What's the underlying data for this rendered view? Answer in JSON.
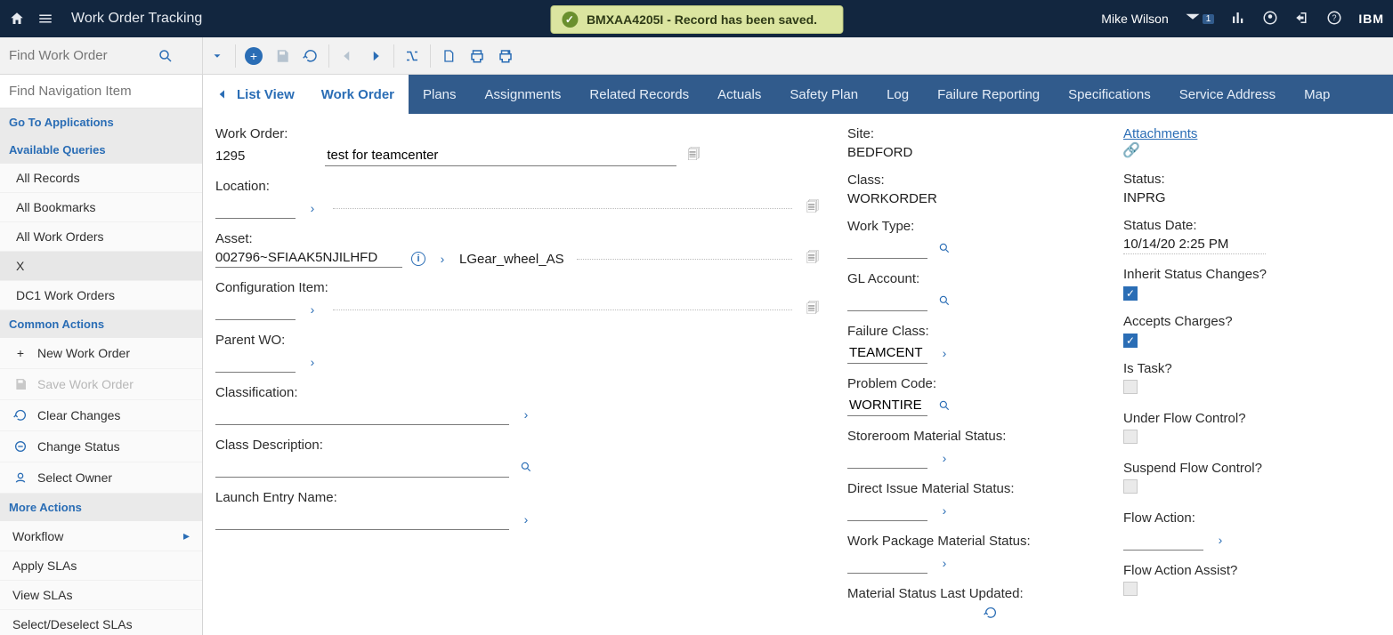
{
  "header": {
    "title": "Work Order Tracking",
    "user": "Mike Wilson",
    "badge_count": "1",
    "brand": "IBM"
  },
  "banner": {
    "text": "BMXAA4205I - Record has been saved."
  },
  "toolbar": {
    "find_placeholder": "Find Work Order"
  },
  "sidebar": {
    "nav_placeholder": "Find Navigation Item",
    "goto_head": "Go To Applications",
    "queries_head": "Available Queries",
    "queries": [
      {
        "label": "All Records"
      },
      {
        "label": "All Bookmarks"
      },
      {
        "label": "All Work Orders"
      },
      {
        "label": "X"
      },
      {
        "label": "DC1 Work Orders"
      }
    ],
    "common_head": "Common Actions",
    "common": [
      {
        "label": "New Work Order",
        "icon": "plus",
        "disabled": false
      },
      {
        "label": "Save Work Order",
        "icon": "save",
        "disabled": true
      },
      {
        "label": "Clear Changes",
        "icon": "undo",
        "disabled": false
      },
      {
        "label": "Change Status",
        "icon": "status",
        "disabled": false
      },
      {
        "label": "Select Owner",
        "icon": "owner",
        "disabled": false
      }
    ],
    "more_head": "More Actions",
    "more": [
      {
        "label": "Workflow",
        "arrow": true
      },
      {
        "label": "Apply SLAs"
      },
      {
        "label": "View SLAs"
      },
      {
        "label": "Select/Deselect SLAs"
      }
    ]
  },
  "tabs": {
    "back": "List View",
    "items": [
      "Work Order",
      "Plans",
      "Assignments",
      "Related Records",
      "Actuals",
      "Safety Plan",
      "Log",
      "Failure Reporting",
      "Specifications",
      "Service Address",
      "Map"
    ],
    "active": 0
  },
  "form": {
    "col1": {
      "work_order_label": "Work Order:",
      "work_order_num": "1295",
      "work_order_desc": "test for teamcenter",
      "location_label": "Location:",
      "location_val": "",
      "asset_label": "Asset:",
      "asset_code": "002796~SFIAAK5NJILHFD",
      "asset_name": "LGear_wheel_AS",
      "config_label": "Configuration Item:",
      "config_val": "",
      "parent_label": "Parent WO:",
      "parent_val": "",
      "classification_label": "Classification:",
      "classification_val": "",
      "classdesc_label": "Class Description:",
      "classdesc_val": "",
      "launch_label": "Launch Entry Name:",
      "launch_val": ""
    },
    "col2": {
      "site_label": "Site:",
      "site_val": "BEDFORD",
      "class_label": "Class:",
      "class_val": "WORKORDER",
      "worktype_label": "Work Type:",
      "worktype_val": "",
      "gl_label": "GL Account:",
      "gl_val": "",
      "failure_label": "Failure Class:",
      "failure_val": "TEAMCENT",
      "problem_label": "Problem Code:",
      "problem_val": "WORNTIRE",
      "storeroom_label": "Storeroom Material Status:",
      "storeroom_val": "",
      "direct_label": "Direct Issue Material Status:",
      "direct_val": "",
      "package_label": "Work Package Material Status:",
      "package_val": "",
      "updated_label": "Material Status Last Updated:",
      "updated_val": ""
    },
    "col3": {
      "attachments": "Attachments",
      "status_label": "Status:",
      "status_val": "INPRG",
      "statusdate_label": "Status Date:",
      "statusdate_val": "10/14/20 2:25 PM",
      "inherit_label": "Inherit Status Changes?",
      "accepts_label": "Accepts Charges?",
      "istask_label": "Is Task?",
      "underflow_label": "Under Flow Control?",
      "suspend_label": "Suspend Flow Control?",
      "flowaction_label": "Flow Action:",
      "flowaction_val": "",
      "flowassist_label": "Flow Action Assist?"
    }
  }
}
